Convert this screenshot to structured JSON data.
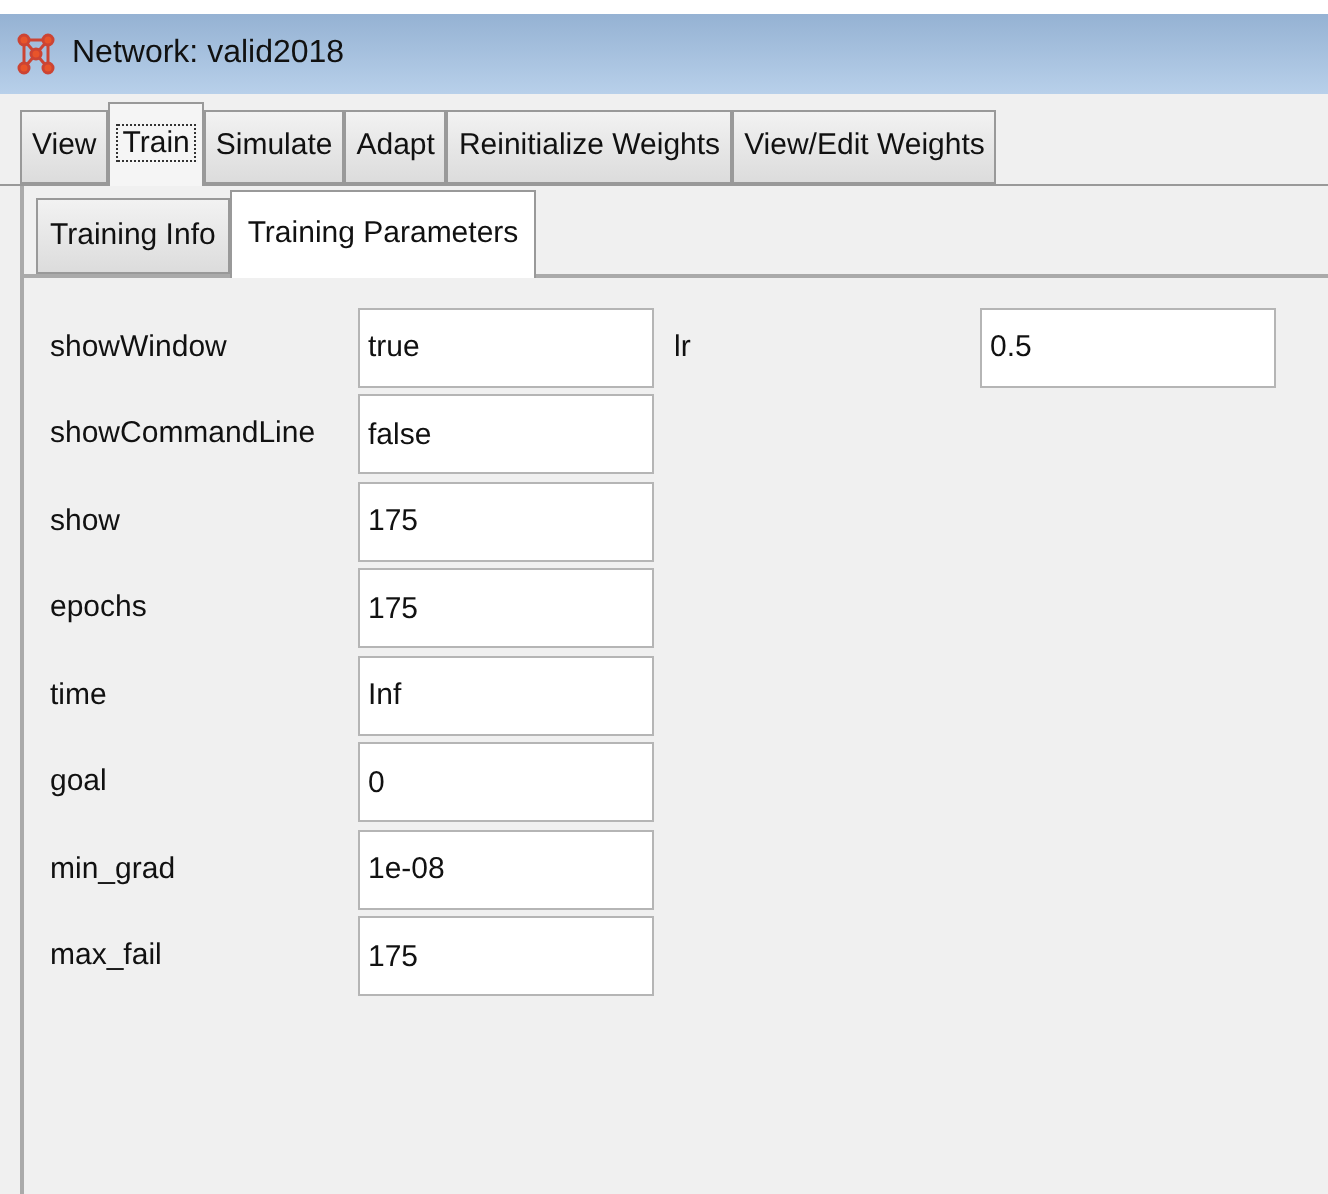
{
  "window": {
    "title": "Network: valid2018"
  },
  "tabs": [
    {
      "label": "View",
      "selected": false
    },
    {
      "label": "Train",
      "selected": true
    },
    {
      "label": "Simulate",
      "selected": false
    },
    {
      "label": "Adapt",
      "selected": false
    },
    {
      "label": "Reinitialize Weights",
      "selected": false
    },
    {
      "label": "View/Edit Weights",
      "selected": false
    }
  ],
  "subtabs": [
    {
      "label": "Training Info",
      "selected": false
    },
    {
      "label": "Training Parameters",
      "selected": true
    }
  ],
  "parameters_left": [
    {
      "label": "showWindow",
      "value": "true"
    },
    {
      "label": "showCommandLine",
      "value": "false"
    },
    {
      "label": "show",
      "value": "175"
    },
    {
      "label": "epochs",
      "value": "175"
    },
    {
      "label": "time",
      "value": "Inf"
    },
    {
      "label": "goal",
      "value": "0"
    },
    {
      "label": "min_grad",
      "value": "1e-08"
    },
    {
      "label": "max_fail",
      "value": "175"
    }
  ],
  "parameters_right": [
    {
      "label": "lr",
      "value": "0.5"
    }
  ]
}
